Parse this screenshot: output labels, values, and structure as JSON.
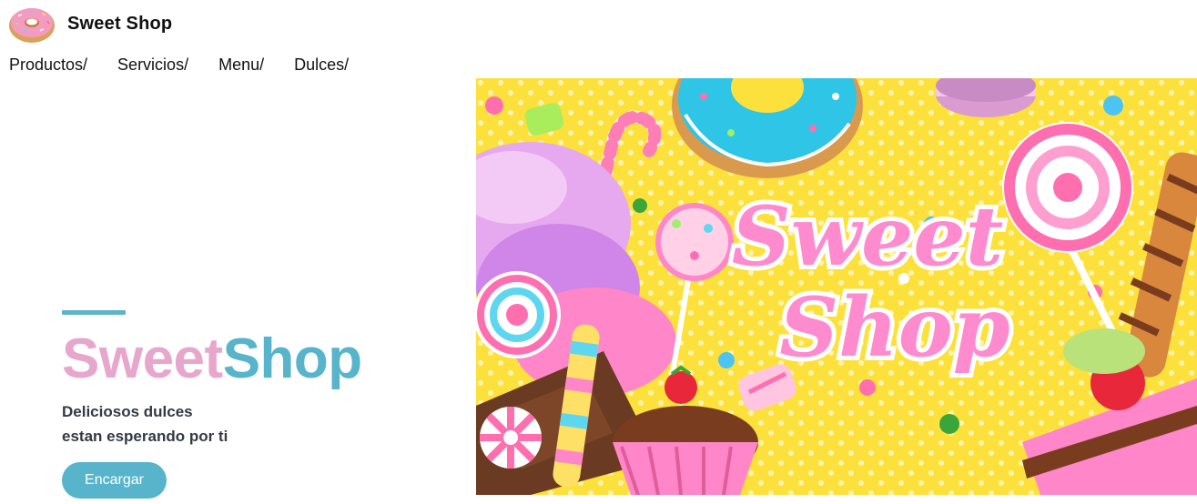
{
  "brand": {
    "name": "Sweet Shop",
    "logo_icon": "donut-icon"
  },
  "nav": {
    "items": [
      {
        "label": "Productos/"
      },
      {
        "label": "Servicios/"
      },
      {
        "label": "Menu/"
      },
      {
        "label": "Dulces/"
      }
    ]
  },
  "hero": {
    "title_part1": "Sweet",
    "title_part2": "Shop",
    "subtitle_line1": "Deliciosos dulces",
    "subtitle_line2": "estan esperando por ti",
    "cta_label": "Encargar",
    "image": {
      "word1": "Sweet",
      "word2": "Shop",
      "description_icons": [
        "donut-icon",
        "lollipop-icon",
        "cupcake-icon",
        "candy-icon",
        "cake-icon",
        "strawberry-icon"
      ]
    }
  },
  "colors": {
    "accent_blue": "#57b4cb",
    "accent_pink": "#e7a7cd",
    "image_background": "#fce13c"
  }
}
